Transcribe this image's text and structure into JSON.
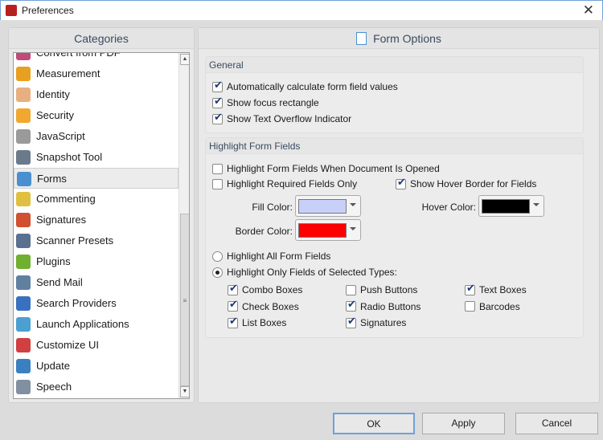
{
  "window": {
    "title": "Preferences",
    "close": "✕"
  },
  "categories": {
    "title": "Categories",
    "items": [
      {
        "label": "Convert from PDF",
        "icon": "convert-icon",
        "color": "#c04a7a"
      },
      {
        "label": "Measurement",
        "icon": "ruler-triangle-icon",
        "color": "#e8a020"
      },
      {
        "label": "Identity",
        "icon": "person-icon",
        "color": "#e8b080"
      },
      {
        "label": "Security",
        "icon": "shield-icon",
        "color": "#f0a830"
      },
      {
        "label": "JavaScript",
        "icon": "script-gear-icon",
        "color": "#9a9a9a"
      },
      {
        "label": "Snapshot Tool",
        "icon": "camera-icon",
        "color": "#6a7a8a"
      },
      {
        "label": "Forms",
        "icon": "form-icon",
        "color": "#4a90d0",
        "selected": true
      },
      {
        "label": "Commenting",
        "icon": "comment-icon",
        "color": "#e0c040"
      },
      {
        "label": "Signatures",
        "icon": "signature-icon",
        "color": "#d05030"
      },
      {
        "label": "Scanner Presets",
        "icon": "scanner-icon",
        "color": "#5a7090"
      },
      {
        "label": "Plugins",
        "icon": "puzzle-icon",
        "color": "#70b030"
      },
      {
        "label": "Send Mail",
        "icon": "mail-icon",
        "color": "#6080a0"
      },
      {
        "label": "Search Providers",
        "icon": "globe-search-icon",
        "color": "#3a70c0"
      },
      {
        "label": "Launch Applications",
        "icon": "launch-icon",
        "color": "#4aa0d0"
      },
      {
        "label": "Customize UI",
        "icon": "tiles-icon",
        "color": "#d04040"
      },
      {
        "label": "Update",
        "icon": "globe-icon",
        "color": "#3a80c0"
      },
      {
        "label": "Speech",
        "icon": "speaker-icon",
        "color": "#8090a0"
      }
    ]
  },
  "form_options": {
    "title": "Form Options",
    "general": {
      "title": "General",
      "options": [
        {
          "label": "Automatically calculate form field values",
          "checked": true
        },
        {
          "label": "Show focus rectangle",
          "checked": true
        },
        {
          "label": "Show Text Overflow Indicator",
          "checked": true
        }
      ]
    },
    "highlight": {
      "title": "Highlight Form Fields",
      "when_opened": {
        "label": "Highlight Form Fields When Document Is Opened",
        "checked": false
      },
      "required_only": {
        "label": "Highlight Required Fields Only",
        "checked": false
      },
      "hover_border": {
        "label": "Show Hover Border for Fields",
        "checked": true
      },
      "fill_color": {
        "label": "Fill Color:",
        "value": "#c8d0fa"
      },
      "hover_color": {
        "label": "Hover Color:",
        "value": "#000000"
      },
      "border_color": {
        "label": "Border Color:",
        "value": "#ff0000"
      },
      "all_fields": {
        "label": "Highlight All Form Fields",
        "selected": false
      },
      "selected_types": {
        "label": "Highlight Only Fields of Selected Types:",
        "selected": true
      },
      "types": [
        {
          "label": "Combo Boxes",
          "checked": true
        },
        {
          "label": "Push Buttons",
          "checked": false
        },
        {
          "label": "Text Boxes",
          "checked": true
        },
        {
          "label": "Check Boxes",
          "checked": true
        },
        {
          "label": "Radio Buttons",
          "checked": true
        },
        {
          "label": "Barcodes",
          "checked": false
        },
        {
          "label": "List Boxes",
          "checked": true
        },
        {
          "label": "Signatures",
          "checked": true
        }
      ]
    }
  },
  "buttons": {
    "ok": "OK",
    "apply": "Apply",
    "cancel": "Cancel"
  }
}
